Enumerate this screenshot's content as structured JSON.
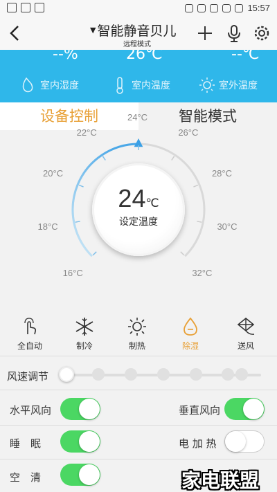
{
  "status_bar": {
    "time": "15:57",
    "battery_icon": "battery-icon"
  },
  "header": {
    "back_icon": "back-icon",
    "title": "智能静音贝儿",
    "subtitle": "远程模式",
    "add_icon": "plus-icon",
    "mic_icon": "microphone-icon",
    "settings_icon": "gear-icon"
  },
  "banner": {
    "humidity_value": "--%",
    "indoor_temp_value": "26℃",
    "outdoor_temp_value": "--℃",
    "humidity_label": "室内湿度",
    "indoor_temp_label": "室内温度",
    "outdoor_temp_label": "室外温度",
    "bg_color": "#2fb7ea"
  },
  "tabs": [
    {
      "label": "设备控制",
      "active": true
    },
    {
      "label": "智能模式",
      "active": false
    }
  ],
  "dial": {
    "current_temp": "24",
    "unit": "℃",
    "set_label": "设定温度",
    "ticks": [
      "16°C",
      "18°C",
      "20°C",
      "22°C",
      "24°C",
      "26°C",
      "28°C",
      "30°C",
      "32°C"
    ],
    "min": 16,
    "max": 32,
    "value": 24
  },
  "modes": [
    {
      "label": "全自动",
      "icon": "touch-hand-icon",
      "active": false
    },
    {
      "label": "制冷",
      "icon": "snowflake-icon",
      "active": false
    },
    {
      "label": "制热",
      "icon": "sun-icon",
      "active": false
    },
    {
      "label": "除湿",
      "icon": "droplet-icon",
      "active": true
    },
    {
      "label": "送风",
      "icon": "fan-kite-icon",
      "active": false
    }
  ],
  "fan_speed": {
    "label": "风速调节",
    "level": 0,
    "steps": 7
  },
  "switches": {
    "horizontal_swing": {
      "label": "水平风向",
      "on": true
    },
    "vertical_swing": {
      "label": "垂直风向",
      "on": true
    },
    "sleep": {
      "label": "睡　眠",
      "on": true
    },
    "electric_heat": {
      "label": "电 加 热",
      "on": false
    },
    "purify": {
      "label": "空　清",
      "on": true
    }
  },
  "watermark": "家电联盟",
  "colors": {
    "accent": "#e8a036",
    "toggle_on": "#4bd763",
    "banner": "#2fb7ea"
  }
}
